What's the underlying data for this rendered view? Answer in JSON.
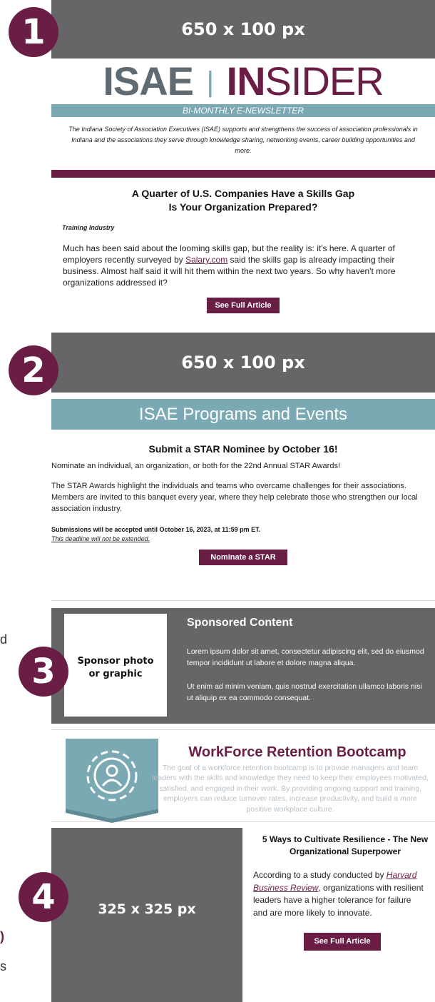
{
  "badges": [
    "1",
    "2",
    "3",
    "4"
  ],
  "sections": {
    "banner1": "650 x 100 px",
    "banner2": "650 x 100 px",
    "banner4": "325 x 325 px"
  },
  "masthead": {
    "isae": "ISAE",
    "divider": "|",
    "in": "IN",
    "sider": "SIDER",
    "subtitle": "BI-MONTHLY E-NEWSLETTER",
    "intro": "The Indiana Society of Association Executives (ISAE) supports and strengthens the success of association professionals in Indiana and the associations they serve through knowledge sharing, networking events, career building opportunities and more."
  },
  "article1": {
    "title_line1": "A Quarter of U.S. Companies Have a Skills Gap",
    "title_line2": "Is Your Organization Prepared?",
    "source": "Training Industry",
    "body_before": "Much has been said about the looming skills gap, but the reality is: it's here. A quarter of employers recently surveyed by ",
    "link": "Salary.com",
    "body_after": " said the skills gap is already impacting their business. Almost half said it will hit them within the next two years. So why haven't more organizations addressed it?",
    "button": "See Full Article"
  },
  "programs": {
    "header": "ISAE Programs and Events",
    "title": "Submit a STAR Nominee by October 16!",
    "para1": "Nominate an individual, an organization, or both for the 22nd Annual STAR Awards!",
    "para2": "The STAR Awards highlight the individuals and teams who overcame challenges for their associations. Members are invited to this banquet every year, where they help celebrate those who strengthen our local association industry.",
    "deadline": "Submissions will be accepted until October 16, 2023, at 11:59 pm ET.",
    "deadline_note": "This deadline will not be extended.",
    "button": "Nominate a STAR"
  },
  "sponsored": {
    "photo_line1": "Sponsor photo",
    "photo_line2": "or graphic",
    "title": "Sponsored Content",
    "para1": "Lorem ipsum dolor sit amet, consectetur adipiscing elit, sed do eiusmod tempor incididunt ut labore et dolore magna aliqua.",
    "para2": "Ut enim ad minim veniam, quis nostrud exercitation ullamco laboris nisi ut aliquip ex ea commodo consequat."
  },
  "bootcamp": {
    "title": "WorkForce Retention Bootcamp",
    "body": "The goal of a workforce retention bootcamp is to provide managers and team leaders with the skills and knowledge they need to keep their employees motivated, satisfied, and engaged in their work. By providing ongoing support and training, employers can reduce turnover rates, increase productivity, and build a more positive workplace culture."
  },
  "article2": {
    "title": "5 Ways to Cultivate Resilience - The New Organizational Superpower",
    "body_before": "According to a study conducted by ",
    "link": "Harvard Business Review",
    "body_after": ", organizations with resilient leaders have a higher tolerance for failure and are more likely to innovate.",
    "button": "See Full Article"
  },
  "edge_fragments": [
    "d",
    ")",
    "s"
  ],
  "colors": {
    "brand_maroon": "#6b1e45",
    "teal": "#7aa9b4",
    "gray": "#666668",
    "masthead_gray": "#5f6a72"
  }
}
